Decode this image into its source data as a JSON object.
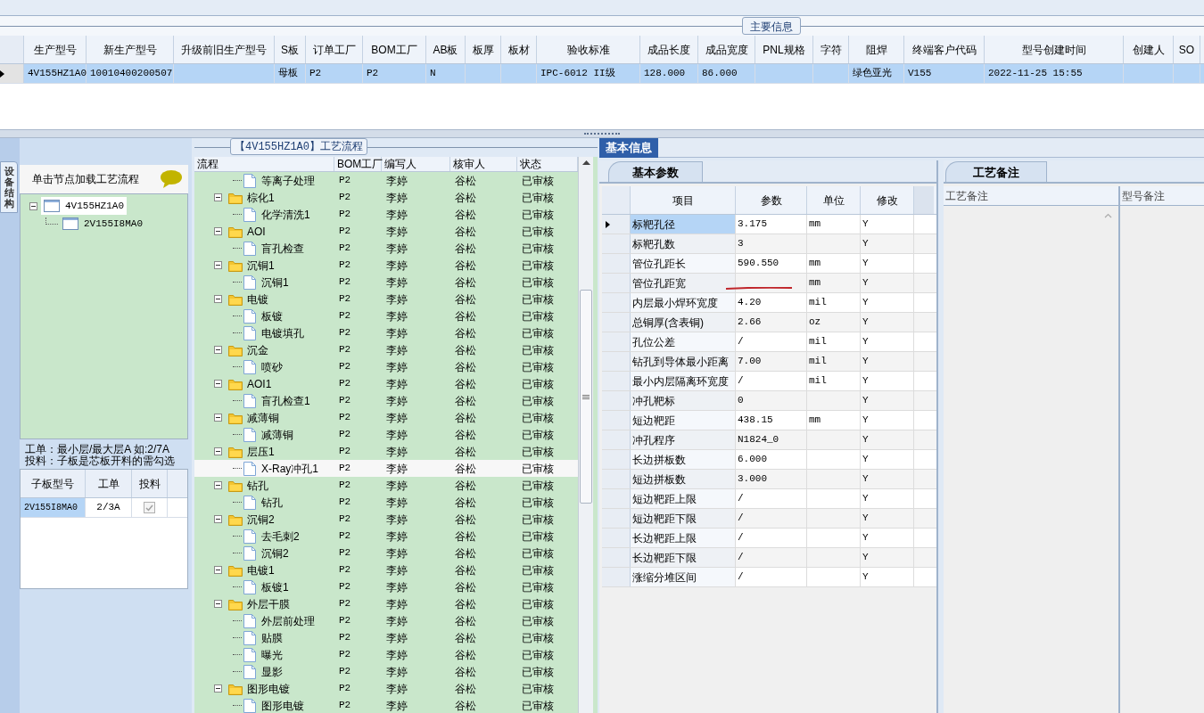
{
  "main_info": {
    "legend": "主要信息",
    "columns": [
      "生产型号",
      "新生产型号",
      "升级前旧生产型号",
      "S板",
      "订单工厂",
      "BOM工厂",
      "AB板",
      "板厚",
      "板材",
      "验收标准",
      "成品长度",
      "成品宽度",
      "PNL规格",
      "字符",
      "阻焊",
      "终端客户代码",
      "型号创建时间",
      "创建人",
      "SO"
    ],
    "rows": [
      {
        "selected": true,
        "cells": [
          "4V155HZ1A0",
          "10010400200507",
          null,
          "母板",
          "P2",
          "P2",
          "N",
          null,
          null,
          "IPC-6012 II级",
          "128.000",
          "86.000",
          null,
          null,
          "绿色亚光",
          "V155",
          "2022-11-25 15:55",
          null,
          null
        ]
      }
    ]
  },
  "structure_tab": {
    "label": "设备结构"
  },
  "structure_panel": {
    "hint": "单击节点加载工艺流程",
    "tree": [
      {
        "label": "4V155HZ1A0",
        "selected": true,
        "expanded": true,
        "children": [
          {
            "label": "2V155I8MA0",
            "selected": false
          }
        ]
      }
    ],
    "notes": [
      "工单：最小层/最大层A 如:2/7A",
      "投料：子板是芯板开料的需勾选"
    ],
    "sub_boards": {
      "columns": [
        "子板型号",
        "工单",
        "投料"
      ],
      "rows": [
        {
          "model": "2V155I8MA0",
          "order": "2/3A",
          "feed": true
        }
      ]
    }
  },
  "flow": {
    "title": "【4V155HZ1A0】工艺流程",
    "columns": [
      "流程",
      "BOM工厂",
      "编写人",
      "核审人",
      "状态"
    ],
    "rows": [
      {
        "name": "等离子处理",
        "kind": "file",
        "bom": "P2",
        "writer": "李婷",
        "reviewer": "谷松",
        "status": "已审核",
        "selected": false
      },
      {
        "name": "棕化1",
        "kind": "folder",
        "bom": "P2",
        "writer": "李婷",
        "reviewer": "谷松",
        "status": "已审核",
        "selected": false,
        "expanded": true,
        "children": [
          {
            "name": "化学清洗1",
            "kind": "file",
            "bom": "P2",
            "writer": "李婷",
            "reviewer": "谷松",
            "status": "已审核",
            "selected": false
          }
        ]
      },
      {
        "name": "AOI",
        "kind": "folder",
        "bom": "P2",
        "writer": "李婷",
        "reviewer": "谷松",
        "status": "已审核",
        "selected": false,
        "expanded": true,
        "children": [
          {
            "name": "盲孔检查",
            "kind": "file",
            "bom": "P2",
            "writer": "李婷",
            "reviewer": "谷松",
            "status": "已审核",
            "selected": false
          }
        ]
      },
      {
        "name": "沉铜1",
        "kind": "folder",
        "bom": "P2",
        "writer": "李婷",
        "reviewer": "谷松",
        "status": "已审核",
        "selected": false,
        "expanded": true,
        "children": [
          {
            "name": "沉铜1",
            "kind": "file",
            "bom": "P2",
            "writer": "李婷",
            "reviewer": "谷松",
            "status": "已审核",
            "selected": false
          }
        ]
      },
      {
        "name": "电镀",
        "kind": "folder",
        "bom": "P2",
        "writer": "李婷",
        "reviewer": "谷松",
        "status": "已审核",
        "selected": false,
        "expanded": true,
        "children": [
          {
            "name": "板镀",
            "kind": "file",
            "bom": "P2",
            "writer": "李婷",
            "reviewer": "谷松",
            "status": "已审核",
            "selected": false
          },
          {
            "name": "电镀填孔",
            "kind": "file",
            "bom": "P2",
            "writer": "李婷",
            "reviewer": "谷松",
            "status": "已审核",
            "selected": false
          }
        ]
      },
      {
        "name": "沉金",
        "kind": "folder",
        "bom": "P2",
        "writer": "李婷",
        "reviewer": "谷松",
        "status": "已审核",
        "selected": false,
        "expanded": true,
        "children": [
          {
            "name": "喷砂",
            "kind": "file",
            "bom": "P2",
            "writer": "李婷",
            "reviewer": "谷松",
            "status": "已审核",
            "selected": false
          }
        ]
      },
      {
        "name": "AOI1",
        "kind": "folder",
        "bom": "P2",
        "writer": "李婷",
        "reviewer": "谷松",
        "status": "已审核",
        "selected": false,
        "expanded": true,
        "children": [
          {
            "name": "盲孔检查1",
            "kind": "file",
            "bom": "P2",
            "writer": "李婷",
            "reviewer": "谷松",
            "status": "已审核",
            "selected": false
          }
        ]
      },
      {
        "name": "减薄铜",
        "kind": "folder",
        "bom": "P2",
        "writer": "李婷",
        "reviewer": "谷松",
        "status": "已审核",
        "selected": false,
        "expanded": true,
        "children": [
          {
            "name": "减薄铜",
            "kind": "file",
            "bom": "P2",
            "writer": "李婷",
            "reviewer": "谷松",
            "status": "已审核",
            "selected": false
          }
        ]
      },
      {
        "name": "层压1",
        "kind": "folder",
        "bom": "P2",
        "writer": "李婷",
        "reviewer": "谷松",
        "status": "已审核",
        "selected": false,
        "expanded": true,
        "children": [
          {
            "name": "X-Ray冲孔1",
            "kind": "file",
            "bom": "P2",
            "writer": "李婷",
            "reviewer": "谷松",
            "status": "已审核",
            "selected": true
          }
        ]
      },
      {
        "name": "钻孔",
        "kind": "folder",
        "bom": "P2",
        "writer": "李婷",
        "reviewer": "谷松",
        "status": "已审核",
        "selected": false,
        "expanded": true,
        "children": [
          {
            "name": "钻孔",
            "kind": "file",
            "bom": "P2",
            "writer": "李婷",
            "reviewer": "谷松",
            "status": "已审核",
            "selected": false
          }
        ]
      },
      {
        "name": "沉铜2",
        "kind": "folder",
        "bom": "P2",
        "writer": "李婷",
        "reviewer": "谷松",
        "status": "已审核",
        "selected": false,
        "expanded": true,
        "children": [
          {
            "name": "去毛刺2",
            "kind": "file",
            "bom": "P2",
            "writer": "李婷",
            "reviewer": "谷松",
            "status": "已审核",
            "selected": false
          },
          {
            "name": "沉铜2",
            "kind": "file",
            "bom": "P2",
            "writer": "李婷",
            "reviewer": "谷松",
            "status": "已审核",
            "selected": false
          }
        ]
      },
      {
        "name": "电镀1",
        "kind": "folder",
        "bom": "P2",
        "writer": "李婷",
        "reviewer": "谷松",
        "status": "已审核",
        "selected": false,
        "expanded": true,
        "children": [
          {
            "name": "板镀1",
            "kind": "file",
            "bom": "P2",
            "writer": "李婷",
            "reviewer": "谷松",
            "status": "已审核",
            "selected": false
          }
        ]
      },
      {
        "name": "外层干膜",
        "kind": "folder",
        "bom": "P2",
        "writer": "李婷",
        "reviewer": "谷松",
        "status": "已审核",
        "selected": false,
        "expanded": true,
        "children": [
          {
            "name": "外层前处理",
            "kind": "file",
            "bom": "P2",
            "writer": "李婷",
            "reviewer": "谷松",
            "status": "已审核",
            "selected": false
          },
          {
            "name": "贴膜",
            "kind": "file",
            "bom": "P2",
            "writer": "李婷",
            "reviewer": "谷松",
            "status": "已审核",
            "selected": false
          },
          {
            "name": "曝光",
            "kind": "file",
            "bom": "P2",
            "writer": "李婷",
            "reviewer": "谷松",
            "status": "已审核",
            "selected": false
          },
          {
            "name": "显影",
            "kind": "file",
            "bom": "P2",
            "writer": "李婷",
            "reviewer": "谷松",
            "status": "已审核",
            "selected": false
          }
        ]
      },
      {
        "name": "图形电镀",
        "kind": "folder",
        "bom": "P2",
        "writer": "李婷",
        "reviewer": "谷松",
        "status": "已审核",
        "selected": false,
        "expanded": true,
        "children": [
          {
            "name": "图形电镀",
            "kind": "file",
            "bom": "P2",
            "writer": "李婷",
            "reviewer": "谷松",
            "status": "已审核",
            "selected": false
          }
        ]
      }
    ]
  },
  "basic_info": {
    "tabs": [
      {
        "label": "基本信息",
        "selected": true
      }
    ],
    "params": {
      "tab": "基本参数",
      "columns": [
        "项目",
        "参数",
        "单位",
        "修改"
      ],
      "rows": [
        {
          "item": "标靶孔径",
          "value": "3.175",
          "unit": "mm",
          "edit": "Y",
          "selected": true
        },
        {
          "item": "标靶孔数",
          "value": "3",
          "edit": "Y",
          "selected": false
        },
        {
          "item": "管位孔距长",
          "value": "590.550",
          "unit": "mm",
          "edit": "Y",
          "selected": false
        },
        {
          "item": "管位孔距宽",
          "unit": "mm",
          "edit": "Y",
          "selected": false
        },
        {
          "item": "内层最小焊环宽度",
          "value": "4.20",
          "unit": "mil",
          "edit": "Y",
          "selected": false
        },
        {
          "item": "总铜厚(含表铜)",
          "value": "2.66",
          "unit": "oz",
          "edit": "Y",
          "selected": false
        },
        {
          "item": "孔位公差",
          "value": "/",
          "unit": "mil",
          "edit": "Y",
          "selected": false
        },
        {
          "item": "钻孔到导体最小距离",
          "value": "7.00",
          "unit": "mil",
          "edit": "Y",
          "selected": false
        },
        {
          "item": "最小内层隔离环宽度",
          "value": "/",
          "unit": "mil",
          "edit": "Y",
          "selected": false
        },
        {
          "item": "冲孔靶标",
          "value": "0",
          "edit": "Y",
          "selected": false
        },
        {
          "item": "短边靶距",
          "value": "438.15",
          "unit": "mm",
          "edit": "Y",
          "selected": false
        },
        {
          "item": "冲孔程序",
          "value": "N1824_0",
          "edit": "Y",
          "selected": false
        },
        {
          "item": "长边拼板数",
          "value": "6.000",
          "edit": "Y",
          "selected": false
        },
        {
          "item": "短边拼板数",
          "value": "3.000",
          "edit": "Y",
          "selected": false
        },
        {
          "item": "短边靶距上限",
          "value": "/",
          "edit": "Y",
          "selected": false
        },
        {
          "item": "短边靶距下限",
          "value": "/",
          "edit": "Y",
          "selected": false
        },
        {
          "item": "长边靶距上限",
          "value": "/",
          "edit": "Y",
          "selected": false
        },
        {
          "item": "长边靶距下限",
          "value": "/",
          "edit": "Y",
          "selected": false
        },
        {
          "item": "涨缩分堆区间",
          "value": "/",
          "edit": "Y",
          "selected": false
        }
      ]
    },
    "notes": {
      "tab": "工艺备注",
      "columns": [
        "工艺备注",
        "型号备注"
      ]
    }
  }
}
